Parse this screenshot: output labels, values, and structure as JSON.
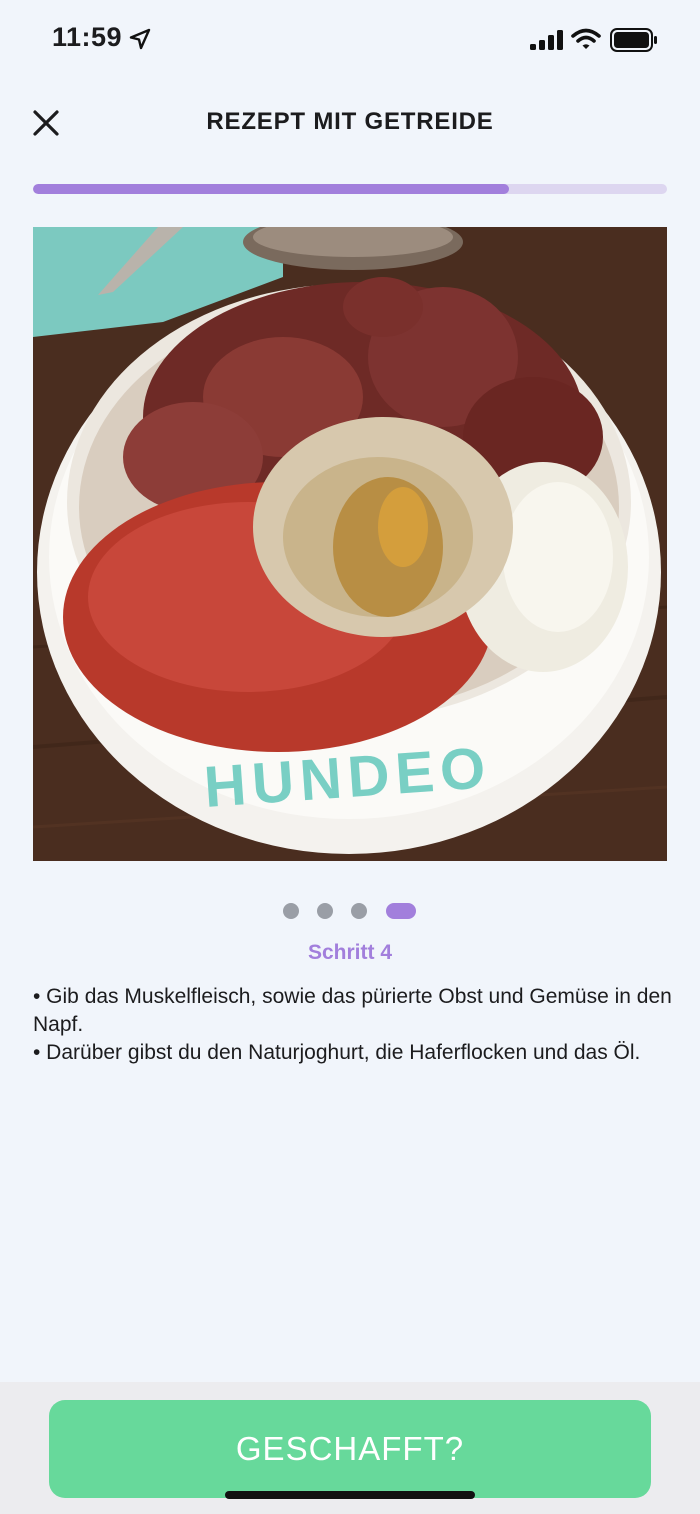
{
  "status_bar": {
    "time": "11:59"
  },
  "header": {
    "title": "REZEPT MIT GETREIDE"
  },
  "progress": {
    "fraction": 0.75
  },
  "image": {
    "bowl_text": "HUNDEO"
  },
  "pager": {
    "total": 4,
    "current": 4
  },
  "step": {
    "label": "Schritt 4",
    "lines": [
      "• Gib das Muskelfleisch, sowie das pürierte Obst und Gemüse in den Napf.",
      "• Darüber gibst du den Naturjoghurt, die Haferflocken und das Öl."
    ]
  },
  "footer": {
    "button_label": "GESCHAFFT?"
  },
  "colors": {
    "accent": "#a27fdc",
    "button": "#67d99b",
    "background": "#f1f5fb"
  }
}
